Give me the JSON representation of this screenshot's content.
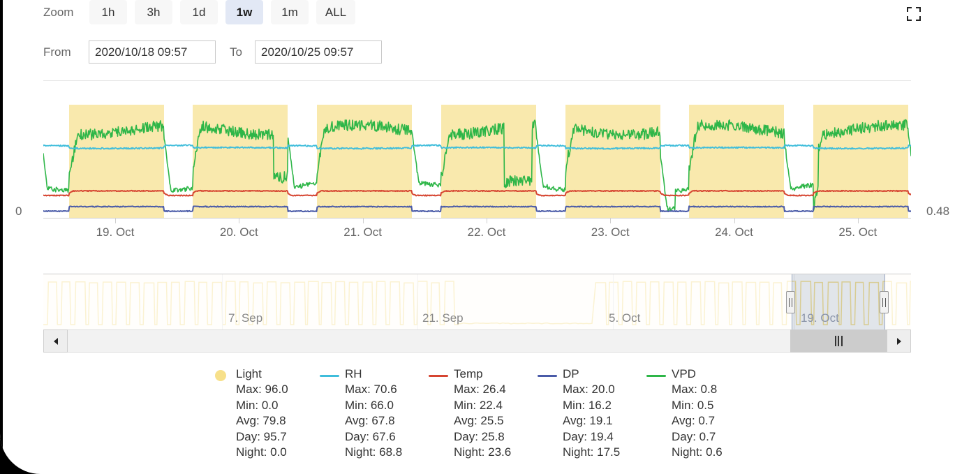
{
  "toolbar": {
    "zoom_label": "Zoom",
    "buttons": [
      {
        "label": "1h",
        "selected": false
      },
      {
        "label": "3h",
        "selected": false
      },
      {
        "label": "1d",
        "selected": false
      },
      {
        "label": "1w",
        "selected": true
      },
      {
        "label": "1m",
        "selected": false
      },
      {
        "label": "ALL",
        "selected": false
      }
    ],
    "from_label": "From",
    "from_value": "2020/10/18 09:57",
    "to_label": "To",
    "to_value": "2020/10/25 09:57",
    "contract_icon": "contract-fullscreen-icon"
  },
  "chart_data": {
    "type": "line",
    "title": "",
    "xlabel": "",
    "ylabel": "",
    "y_axis_left": {
      "label": "0",
      "min": 0
    },
    "y_axis_right": {
      "label": "0.48"
    },
    "x_tick_labels": [
      "19. Oct",
      "20. Oct",
      "21. Oct",
      "22. Oct",
      "23. Oct",
      "24. Oct",
      "25. Oct"
    ],
    "grid": false,
    "legend_position": "bottom",
    "plot_bands_label": "Light (day) shaded bands",
    "series": [
      {
        "name": "Light",
        "color": "#F7E08A",
        "symbol": "dot",
        "stats": {
          "Max": "96.0",
          "Min": "0.0",
          "Avg": "79.8",
          "Day": "95.7",
          "Night": "0.0"
        },
        "max": 96.0,
        "min": 0.0,
        "avg": 79.8,
        "day": 95.7,
        "night": 0.0
      },
      {
        "name": "RH",
        "color": "#3FBDDB",
        "symbol": "line",
        "stats": {
          "Max": "70.6",
          "Min": "66.0",
          "Avg": "67.8",
          "Day": "67.6",
          "Night": "68.8"
        },
        "max": 70.6,
        "min": 66.0,
        "avg": 67.8,
        "day": 67.6,
        "night": 68.8
      },
      {
        "name": "Temp",
        "color": "#D64531",
        "symbol": "line",
        "stats": {
          "Max": "26.4",
          "Min": "22.4",
          "Avg": "25.5",
          "Day": "25.8",
          "Night": "23.6"
        },
        "max": 26.4,
        "min": 22.4,
        "avg": 25.5,
        "day": 25.8,
        "night": 23.6
      },
      {
        "name": "DP",
        "color": "#4A5BA8",
        "symbol": "line",
        "stats": {
          "Max": "20.0",
          "Min": "16.2",
          "Avg": "19.1",
          "Day": "19.4",
          "Night": "17.5"
        },
        "max": 20.0,
        "min": 16.2,
        "avg": 19.1,
        "day": 19.4,
        "night": 17.5
      },
      {
        "name": "VPD",
        "color": "#2EB648",
        "symbol": "line",
        "stats": {
          "Max": "0.8",
          "Min": "0.5",
          "Avg": "0.7",
          "Day": "0.7",
          "Night": "0.6"
        },
        "max": 0.8,
        "min": 0.5,
        "avg": 0.7,
        "day": 0.7,
        "night": 0.6
      }
    ],
    "stat_order": [
      "Max",
      "Min",
      "Avg",
      "Day",
      "Night"
    ]
  },
  "navigator": {
    "x_tick_labels": [
      "7. Sep",
      "21. Sep",
      "5. Oct",
      "19. Oct"
    ],
    "selection_label": "19. Oct",
    "series_color": "#F3DE8A",
    "left_arrow": "scroll-left-arrow",
    "right_arrow": "scroll-right-arrow"
  }
}
